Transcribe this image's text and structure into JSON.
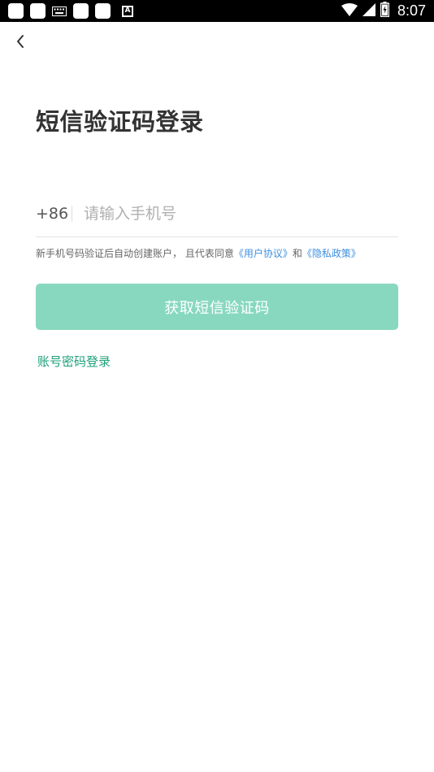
{
  "status_bar": {
    "time": "8:07",
    "icons": [
      "app-icon",
      "app-icon",
      "keyboard-icon",
      "app-icon",
      "app-icon",
      "a-icon",
      "wifi-icon",
      "cellular-signal-icon",
      "battery-icon"
    ],
    "a_glyph": "A"
  },
  "header": {
    "back_icon": "chevron-left-icon"
  },
  "title": "短信验证码登录",
  "phone": {
    "country_code": "+86",
    "placeholder": "请输入手机号",
    "value": ""
  },
  "agreement": {
    "prefix": "新手机号码验证后自动创建账户， 且代表同意",
    "user_agreement": "《用户协议》",
    "conjunction": "和",
    "privacy_policy": "《隐私政策》"
  },
  "submit_label": "获取短信验证码",
  "password_login_label": "账号密码登录",
  "colors": {
    "accent": "#1ea07a",
    "button_disabled": "#88d8c0",
    "link": "#3d8fe0",
    "title": "#333333",
    "status_bar": "#000000"
  }
}
